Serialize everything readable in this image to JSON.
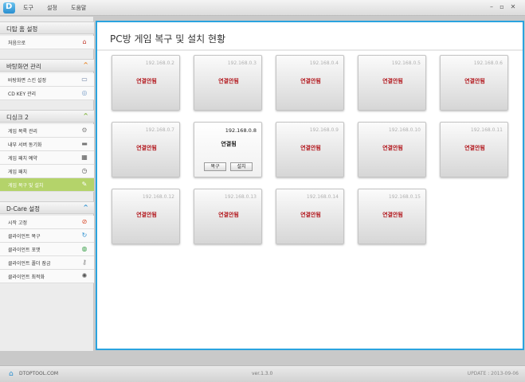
{
  "menu": {
    "items": [
      "도구",
      "설정",
      "도움말"
    ]
  },
  "window_controls": {
    "minimize": "–",
    "restore": "▫",
    "close": "✕"
  },
  "sidebar": {
    "sections": [
      {
        "title": "디탑 홈 설정",
        "chevron": "",
        "items": [
          {
            "label": "처음으로",
            "icon": "home-icon",
            "glyph": "⌂",
            "color": "#c0392b"
          }
        ]
      },
      {
        "title": "바탕화면 관리",
        "chevron": "^",
        "chevron_color": "#e8892b",
        "items": [
          {
            "label": "바탕화면 스킨 설정",
            "icon": "monitor-icon",
            "glyph": "▭",
            "color": "#6a7fa0"
          },
          {
            "label": "CD KEY 관리",
            "icon": "disc-icon",
            "glyph": "◎",
            "color": "#7a9fc9"
          }
        ]
      },
      {
        "title": "디싱크 2",
        "chevron": "^",
        "chevron_color": "#7fb33a",
        "items": [
          {
            "label": "게임 목록 관리",
            "icon": "gear-icon",
            "glyph": "⚙",
            "color": "#888"
          },
          {
            "label": "내부 서버 동기화",
            "icon": "server-icon",
            "glyph": "▬",
            "color": "#777"
          },
          {
            "label": "게임 패치 예약",
            "icon": "calendar-icon",
            "glyph": "▦",
            "color": "#555"
          },
          {
            "label": "게임 패치",
            "icon": "clock-icon",
            "glyph": "◷",
            "color": "#555"
          },
          {
            "label": "게임 복구 및 설치",
            "icon": "wrench-icon",
            "glyph": "✎",
            "color": "#fff",
            "active": true
          }
        ]
      },
      {
        "title": "D-Care 설정",
        "chevron": "^",
        "chevron_color": "#2a8fd0",
        "items": [
          {
            "label": "시작 고정",
            "icon": "block-icon",
            "glyph": "⊘",
            "color": "#d84a2a"
          },
          {
            "label": "클라이언트 복구",
            "icon": "restore-icon",
            "glyph": "↻",
            "color": "#2a8fd0"
          },
          {
            "label": "클라이언트 포맷",
            "icon": "globe-icon",
            "glyph": "◍",
            "color": "#3aa04a"
          },
          {
            "label": "클라이언트 폴더 잠금",
            "icon": "lock-icon",
            "glyph": "⚷",
            "color": "#888"
          },
          {
            "label": "클라이언트 최적화",
            "icon": "spinner-icon",
            "glyph": "✺",
            "color": "#555"
          }
        ]
      }
    ]
  },
  "main": {
    "title": "PC방 게임 복구 및 설치 현황",
    "pcs": [
      {
        "ip": "192.168.0.2",
        "status": "연결안됨",
        "connected": false
      },
      {
        "ip": "192.168.0.3",
        "status": "연결안됨",
        "connected": false
      },
      {
        "ip": "192.168.0.4",
        "status": "연결안됨",
        "connected": false
      },
      {
        "ip": "192.168.0.5",
        "status": "연결안됨",
        "connected": false
      },
      {
        "ip": "192.168.0.6",
        "status": "연결안됨",
        "connected": false
      },
      {
        "ip": "192.168.0.7",
        "status": "연결안됨",
        "connected": false
      },
      {
        "ip": "192.168.0.8",
        "status": "연결됨",
        "connected": true,
        "buttons": [
          "복구",
          "설치"
        ]
      },
      {
        "ip": "192.168.0.9",
        "status": "연결안됨",
        "connected": false
      },
      {
        "ip": "192.168.0.10",
        "status": "연결안됨",
        "connected": false
      },
      {
        "ip": "192.168.0.11",
        "status": "연결안됨",
        "connected": false
      },
      {
        "ip": "192.168.0.12",
        "status": "연결안됨",
        "connected": false
      },
      {
        "ip": "192.168.0.13",
        "status": "연결안됨",
        "connected": false
      },
      {
        "ip": "192.168.0.14",
        "status": "연결안됨",
        "connected": false
      },
      {
        "ip": "192.168.0.15",
        "status": "연결안됨",
        "connected": false
      }
    ]
  },
  "footer": {
    "site": "DTOPTOOL.COM",
    "version": "ver.1.3.0",
    "update": "UPDATE : 2013-09-06"
  },
  "colors": {
    "accent": "#2aa3df",
    "active_item": "#b4d36a",
    "disconnected": "#b2151b"
  }
}
